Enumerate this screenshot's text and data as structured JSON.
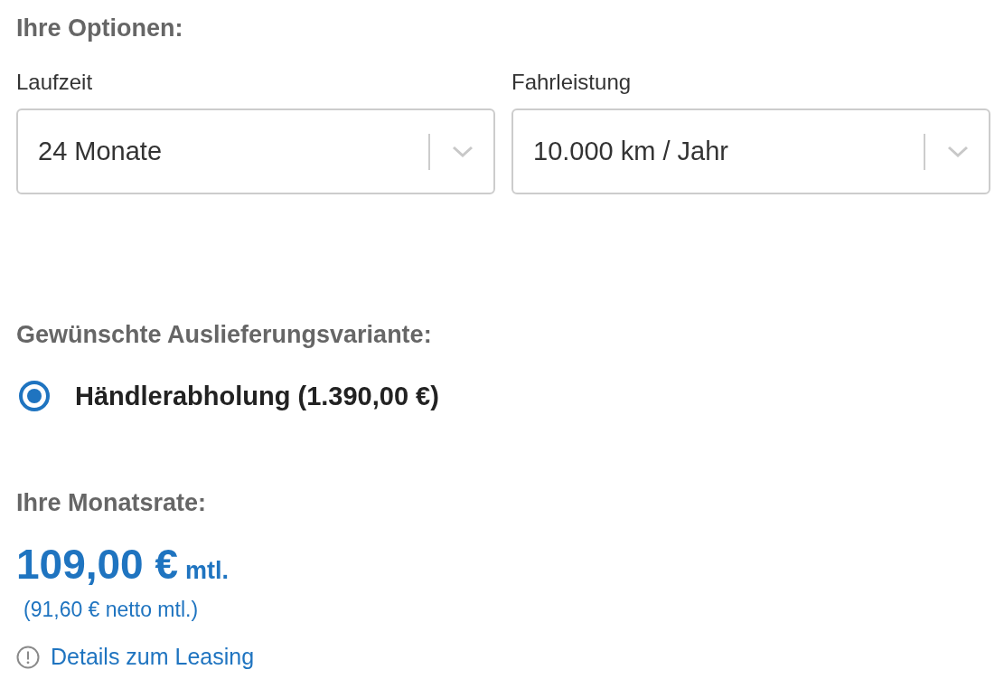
{
  "options_heading": "Ihre Optionen:",
  "selects": [
    {
      "label": "Laufzeit",
      "value": "24 Monate"
    },
    {
      "label": "Fahrleistung",
      "value": "10.000 km / Jahr"
    }
  ],
  "delivery_heading": "Gewünschte Auslieferungsvariante:",
  "delivery_options": [
    {
      "label": "Händlerabholung (1.390,00 €)",
      "selected": true
    }
  ],
  "rate_heading": "Ihre Monatsrate:",
  "price": {
    "amount": "109,00 €",
    "suffix": "mtl.",
    "net": "(91,60 € netto mtl.)"
  },
  "details_link": "Details zum Leasing"
}
